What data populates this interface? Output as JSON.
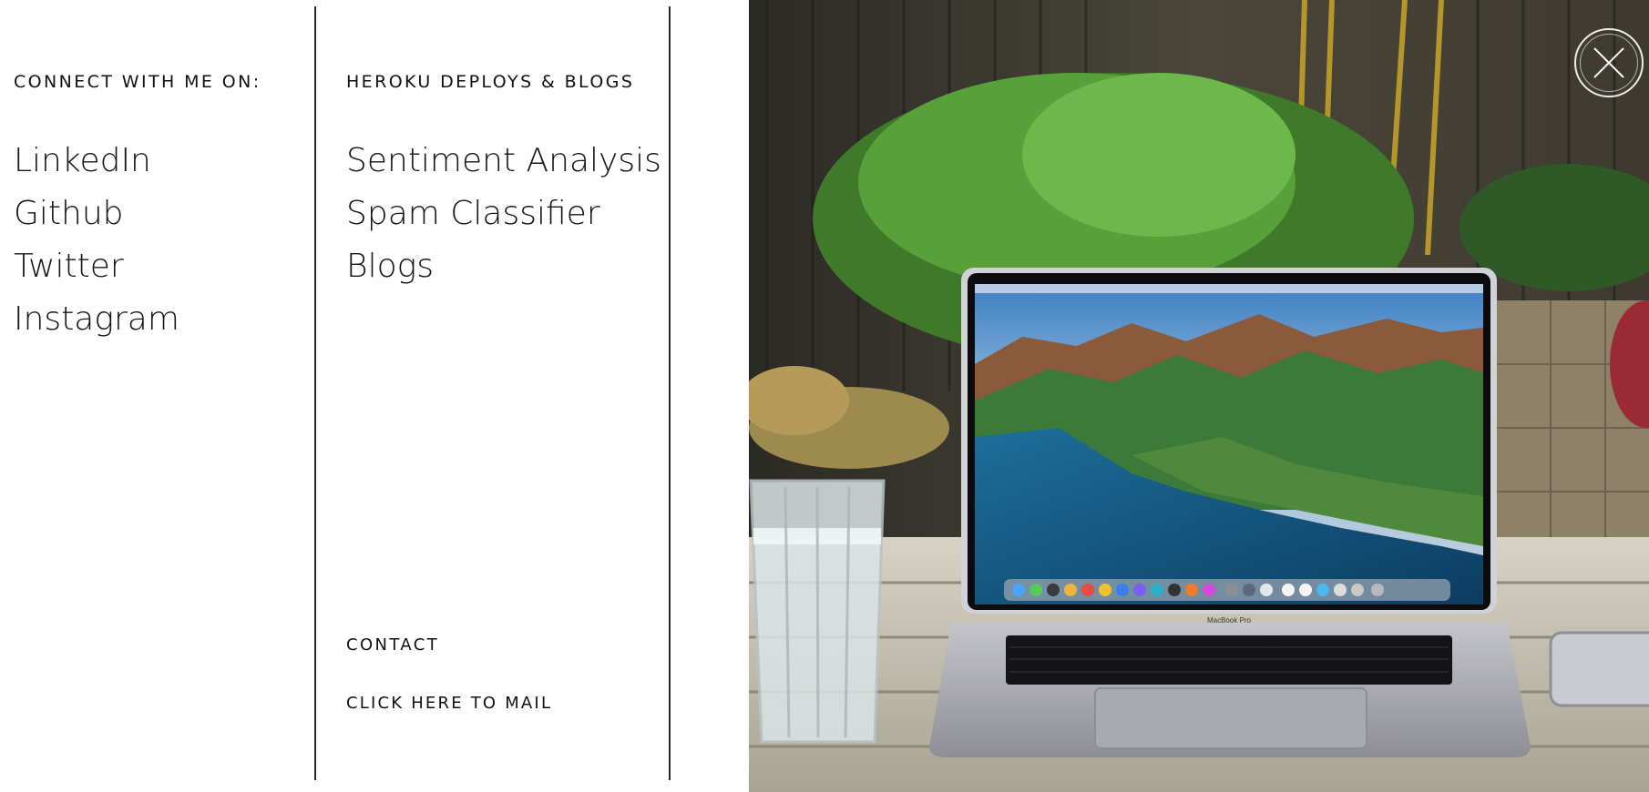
{
  "social": {
    "heading": "CONNECT WITH ME ON:",
    "links": [
      "LinkedIn",
      "Github",
      "Twitter",
      "Instagram"
    ]
  },
  "projects": {
    "heading": "HEROKU DEPLOYS & BLOGS",
    "links": [
      "Sentiment Analysis",
      "Spam Classifier",
      "Blogs"
    ]
  },
  "contact": {
    "label": "CONTACT",
    "mail_link": "CLICK HERE TO MAIL"
  },
  "photo": {
    "laptop_label": "MacBook Pro",
    "icons": {
      "close": "close-icon"
    }
  },
  "colors": {
    "text": "#111111",
    "divider": "#2a2a2a",
    "background": "#ffffff"
  }
}
